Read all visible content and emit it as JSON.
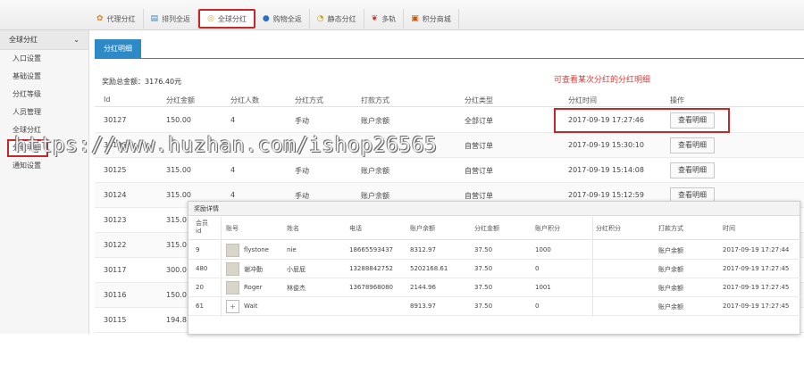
{
  "topnav": [
    {
      "label": "代理分红",
      "icon": "gift-icon",
      "active": false
    },
    {
      "label": "排列全返",
      "icon": "list-icon",
      "active": false
    },
    {
      "label": "全球分红",
      "icon": "globe-icon",
      "active": true
    },
    {
      "label": "购物全返",
      "icon": "cart-icon",
      "active": false
    },
    {
      "label": "静态分红",
      "icon": "clock-icon",
      "active": false
    },
    {
      "label": "多轨",
      "icon": "track-icon",
      "active": false
    },
    {
      "label": "积分商城",
      "icon": "shop-icon",
      "active": false
    }
  ],
  "sidebar": {
    "header": "全球分红",
    "items": [
      "入口设置",
      "基础设置",
      "分红等级",
      "人员管理",
      "全球分红",
      "分红明细",
      "通知设置"
    ]
  },
  "main": {
    "tab": "分红明细",
    "total": "奖励总金额：3176.40元",
    "note": "可查看某次分红的分红明细",
    "columns": [
      "Id",
      "分红金额",
      "分红人数",
      "分红方式",
      "打款方式",
      "分红类型",
      "分红时间",
      "操作"
    ],
    "rows": [
      {
        "id": "30127",
        "amount": "150.00",
        "count": "4",
        "method": "手动",
        "payment": "账户余额",
        "type": "全部订单",
        "time": "2017-09-19 17:27:46",
        "action": "查看明细"
      },
      {
        "id": "30126",
        "amount": "",
        "count": "",
        "method": "",
        "payment": "",
        "type": "自营订单",
        "time": "2017-09-19 15:30:10",
        "action": "查看明细"
      },
      {
        "id": "30125",
        "amount": "315.00",
        "count": "4",
        "method": "手动",
        "payment": "账户余额",
        "type": "自营订单",
        "time": "2017-09-19 15:14:08",
        "action": "查看明细"
      },
      {
        "id": "30124",
        "amount": "315.00",
        "count": "4",
        "method": "手动",
        "payment": "账户余额",
        "type": "自营订单",
        "time": "2017-09-19 15:12:59",
        "action": "查看明细"
      },
      {
        "id": "30123",
        "amount": "315.0",
        "count": "",
        "method": "",
        "payment": "",
        "type": "",
        "time": "",
        "action": ""
      },
      {
        "id": "30122",
        "amount": "315.0",
        "count": "",
        "method": "",
        "payment": "",
        "type": "",
        "time": "",
        "action": ""
      },
      {
        "id": "30117",
        "amount": "300.0",
        "count": "",
        "method": "",
        "payment": "",
        "type": "",
        "time": "",
        "action": ""
      },
      {
        "id": "30116",
        "amount": "150.0",
        "count": "",
        "method": "",
        "payment": "",
        "type": "",
        "time": "",
        "action": ""
      },
      {
        "id": "30115",
        "amount": "194.8",
        "count": "",
        "method": "",
        "payment": "",
        "type": "",
        "time": "",
        "action": ""
      }
    ]
  },
  "popup": {
    "title": "奖励详情",
    "columns": [
      "会员\nid",
      "账号",
      "姓名",
      "电话",
      "账户余额",
      "分红金额",
      "账户积分",
      "分红积分",
      "打款方式",
      "时间"
    ],
    "rows": [
      {
        "member_id": "9",
        "account": "flystone",
        "name": "nie",
        "phone": "18665593437",
        "balance": "8312.97",
        "amount": "37.50",
        "points": "1000",
        "bonus_points": "",
        "payment": "账户余额",
        "time": "2017-09-19 17:27:44"
      },
      {
        "member_id": "480",
        "account": "谢冲勤",
        "name": "小屁屁",
        "phone": "13288842752",
        "balance": "5202168.61",
        "amount": "37.50",
        "points": "0",
        "bonus_points": "",
        "payment": "账户余额",
        "time": "2017-09-19 17:27:45"
      },
      {
        "member_id": "20",
        "account": "Roger",
        "name": "林俊杰",
        "phone": "13678968080",
        "balance": "2144.96",
        "amount": "37.50",
        "points": "1001",
        "bonus_points": "",
        "payment": "账户余额",
        "time": "2017-09-19 17:27:45"
      },
      {
        "member_id": "61",
        "account": "Wait",
        "name": "",
        "phone": "",
        "balance": "8913.97",
        "amount": "37.50",
        "points": "0",
        "bonus_points": "",
        "payment": "账户余额",
        "time": "2017-09-19 17:27:45"
      }
    ]
  },
  "watermark": "https://www.huzhan.com/ishop26565",
  "colors": {
    "accent": "#2d8ac7",
    "highlight": "#c62828",
    "note": "#e53935"
  }
}
